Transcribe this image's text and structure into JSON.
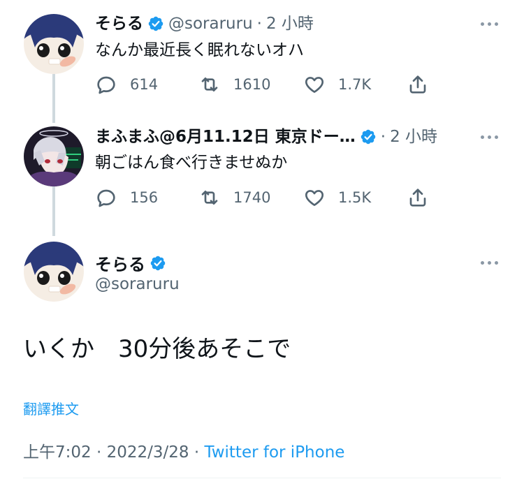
{
  "tweets": [
    {
      "name": "そらる",
      "handle": "@soraruru",
      "sep": "·",
      "time": "2 小時",
      "text": "なんか最近長く眠れないオハ",
      "replies": "614",
      "retweets": "1610",
      "likes": "1.7K"
    },
    {
      "name": "まふまふ@6月11.12日 東京ドー…",
      "sep": "·",
      "time": "2 小時",
      "text": "朝ごはん食べ行きませぬか",
      "replies": "156",
      "retweets": "1740",
      "likes": "1.5K"
    }
  ],
  "main": {
    "name": "そらる",
    "handle": "@soraruru",
    "text": "いくか　30分後あそこで",
    "translate": "翻譯推文",
    "time": "上午7:02",
    "sep1": "·",
    "date": "2022/3/28",
    "sep2": "·",
    "source": "Twitter for iPhone"
  },
  "icons": [
    "verified-badge-icon",
    "more-icon",
    "reply-icon",
    "retweet-icon",
    "like-icon",
    "share-icon"
  ],
  "colors": {
    "accent": "#1d9bf0",
    "muted": "#536471",
    "thread_line": "#cfd9de"
  }
}
